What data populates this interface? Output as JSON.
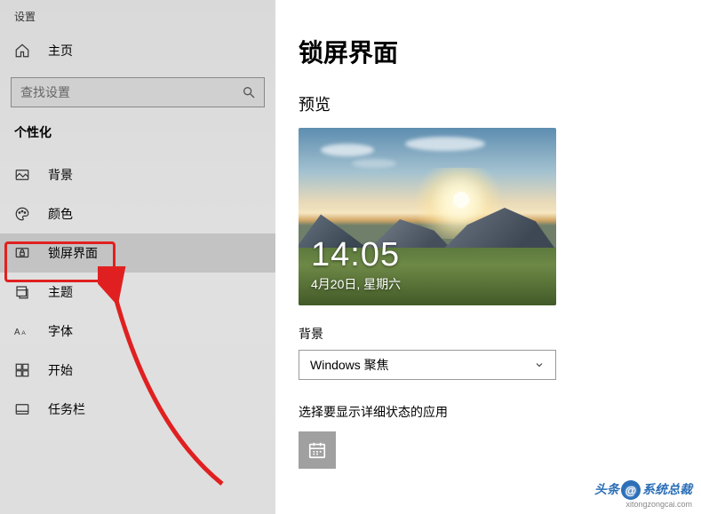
{
  "app_title": "设置",
  "home_label": "主页",
  "search": {
    "placeholder": "查找设置"
  },
  "section_header": "个性化",
  "sidebar": {
    "items": [
      {
        "label": "背景"
      },
      {
        "label": "颜色"
      },
      {
        "label": "锁屏界面"
      },
      {
        "label": "主题"
      },
      {
        "label": "字体"
      },
      {
        "label": "开始"
      },
      {
        "label": "任务栏"
      }
    ]
  },
  "main": {
    "title": "锁屏界面",
    "preview_label": "预览",
    "preview_time": "14:05",
    "preview_date": "4月20日, 星期六",
    "background_label": "背景",
    "dropdown_selected": "Windows 聚焦",
    "detail_label": "选择要显示详细状态的应用"
  },
  "watermark": {
    "prefix": "头条",
    "badge": "@",
    "text": "系统总裁",
    "sub": "xitongzongcai.com"
  }
}
